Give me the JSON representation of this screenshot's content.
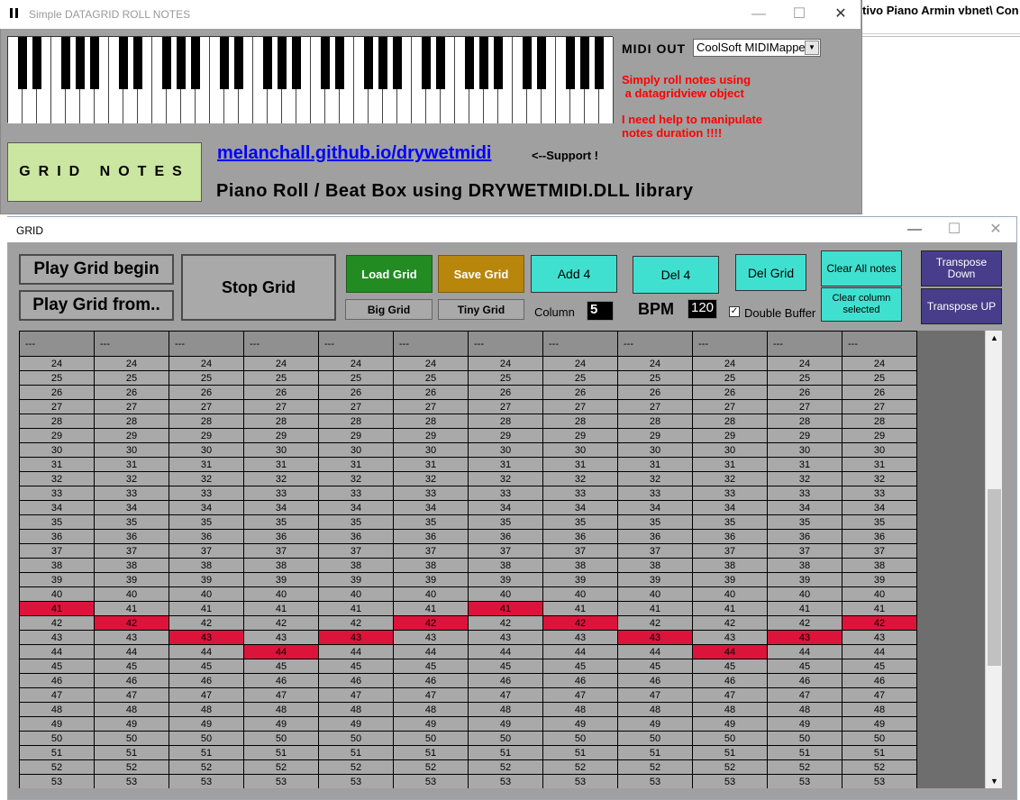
{
  "background_window": {
    "title_fragment": "tivo Piano Armin vbnet\\ Con"
  },
  "main_window": {
    "title": "Simple DATAGRID ROLL NOTES",
    "controls": {
      "minimize": "—",
      "maximize": "☐",
      "close": "✕"
    },
    "midi_out_label": "MIDI  OUT",
    "midi_out_value": "CoolSoft MIDIMapper",
    "note1": "Simply roll notes using\n a datagridview object",
    "note2": "I need help to manipulate\nnotes duration !!!!",
    "grid_notes_label": "GRID  NOTES",
    "link_text": "melanchall.github.io/drywetmidi",
    "support_text": "<--Support !",
    "description": "Piano Roll  /  Beat Box  using  DRYWETMIDI.DLL library"
  },
  "grid_window": {
    "title": "GRID",
    "controls": {
      "minimize": "—",
      "maximize": "☐",
      "close": "✕"
    },
    "buttons": {
      "play_begin": "Play Grid begin",
      "play_from": "Play Grid from..",
      "stop": "Stop Grid",
      "load": "Load Grid",
      "save": "Save Grid",
      "big": "Big Grid",
      "tiny": "Tiny Grid",
      "add4": "Add 4",
      "del4": "Del 4",
      "delgrid": "Del Grid",
      "clear_all": "Clear All notes",
      "clear_col": "Clear column selected",
      "transpose_down": "Transpose Down",
      "transpose_up": "Transpose UP"
    },
    "column_label": "Column",
    "column_value": "5",
    "bpm_label": "BPM",
    "bpm_value": "120",
    "double_buffer_label": "Double Buffer",
    "double_buffer_checked": true,
    "header_cell": "---",
    "column_count": 12,
    "rows_start": 24,
    "rows_end": 53,
    "active_notes": [
      41,
      42,
      43,
      44,
      43,
      42,
      41,
      42,
      43,
      44,
      43,
      42
    ],
    "active_color": "#dc143c"
  }
}
